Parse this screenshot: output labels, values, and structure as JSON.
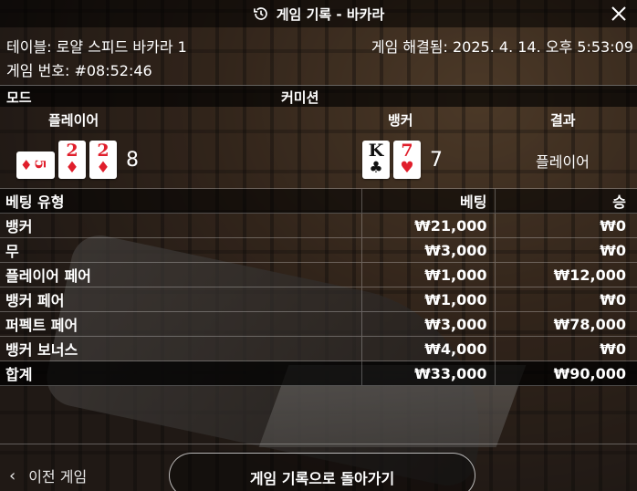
{
  "header": {
    "title": "게임 기록 - 바카라"
  },
  "info": {
    "table_label": "테이블: 로얄 스피드 바카라 1",
    "game_number": "게임 번호: #08:52:46",
    "resolved": "게임 해결됨: 2025. 4. 14. 오후 5:53:09"
  },
  "mode_row": {
    "mode": "모드",
    "commission": "커미션"
  },
  "result_header": {
    "player": "플레이어",
    "banker": "뱅커",
    "result": "결과"
  },
  "player_hand": {
    "cards": [
      {
        "rank": "5",
        "suit": "♦",
        "color": "red",
        "orientation": "sideways"
      },
      {
        "rank": "2",
        "suit": "♦",
        "color": "red"
      },
      {
        "rank": "2",
        "suit": "♦",
        "color": "red"
      }
    ],
    "score": "8"
  },
  "banker_hand": {
    "cards": [
      {
        "rank": "K",
        "suit": "♣",
        "color": "black"
      },
      {
        "rank": "7",
        "suit": "♥",
        "color": "red"
      }
    ],
    "score": "7"
  },
  "result": "플레이어",
  "bets": {
    "headers": {
      "type": "베팅 유형",
      "bet": "베팅",
      "win": "승"
    },
    "rows": [
      {
        "type": "뱅커",
        "bet": "₩21,000",
        "win": "₩0"
      },
      {
        "type": "무",
        "bet": "₩3,000",
        "win": "₩0"
      },
      {
        "type": "플레이어 페어",
        "bet": "₩1,000",
        "win": "₩12,000"
      },
      {
        "type": "뱅커 페어",
        "bet": "₩1,000",
        "win": "₩0"
      },
      {
        "type": "퍼펙트 페어",
        "bet": "₩3,000",
        "win": "₩78,000"
      },
      {
        "type": "뱅커 보너스",
        "bet": "₩4,000",
        "win": "₩0"
      }
    ],
    "total": {
      "type": "합계",
      "bet": "₩33,000",
      "win": "₩90,000"
    }
  },
  "footer": {
    "prev_label": "이전 게임",
    "back_label": "게임 기록으로 돌아가기"
  },
  "colors": {
    "red_suit": "#e01e2b",
    "black_suit": "#111111"
  },
  "icons": [
    "history-icon",
    "close-icon",
    "chevron-left-icon"
  ]
}
